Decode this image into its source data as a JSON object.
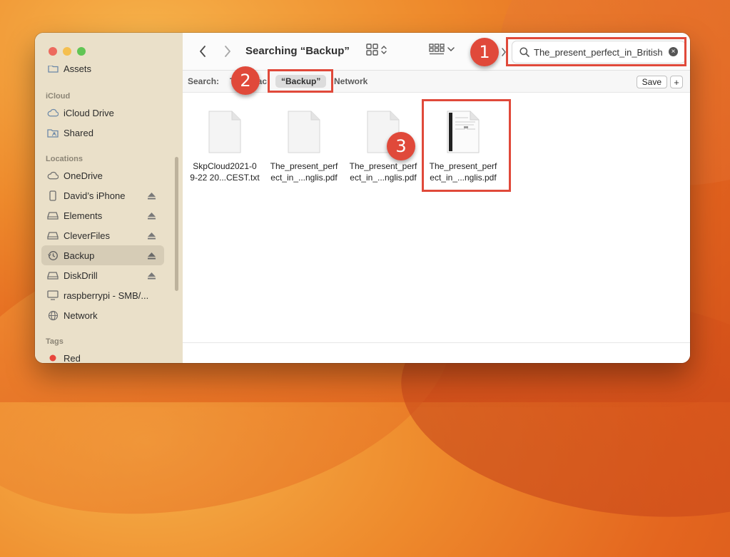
{
  "sidebar": {
    "items_top": [
      {
        "label": "Assets",
        "icon": "folder-icon"
      }
    ],
    "sections": [
      {
        "title": "iCloud",
        "items": [
          {
            "label": "iCloud Drive",
            "icon": "cloud-icon"
          },
          {
            "label": "Shared",
            "icon": "shared-folder-icon"
          }
        ]
      },
      {
        "title": "Locations",
        "items": [
          {
            "label": "OneDrive",
            "icon": "cloud-icon"
          },
          {
            "label": "David’s iPhone",
            "icon": "iphone-icon",
            "eject": true
          },
          {
            "label": "Elements",
            "icon": "drive-icon",
            "eject": true
          },
          {
            "label": "CleverFiles",
            "icon": "drive-icon",
            "eject": true
          },
          {
            "label": "Backup",
            "icon": "time-machine-icon",
            "eject": true,
            "selected": true
          },
          {
            "label": "DiskDrill",
            "icon": "drive-icon",
            "eject": true
          },
          {
            "label": "raspberrypi - SMB/...",
            "icon": "display-icon"
          },
          {
            "label": "Network",
            "icon": "globe-icon"
          }
        ]
      },
      {
        "title": "Tags",
        "items": [
          {
            "label": "Red",
            "icon": "red-tag-icon",
            "color": "#e8453c"
          }
        ]
      }
    ]
  },
  "toolbar": {
    "title": "Searching “Backup”",
    "search_value": "The_present_perfect_in_British"
  },
  "scope": {
    "label": "Search:",
    "partial_mac": "Th",
    "partial_mac_tail": "ac",
    "backup": "“Backup”",
    "network": "Network",
    "save": "Save",
    "plus": "+"
  },
  "files": [
    {
      "name": "SkpCloud2021-0\n9-22 20...CEST.txt",
      "thumb": "blank"
    },
    {
      "name": "The_present_perf\nect_in_...nglis.pdf",
      "thumb": "blank"
    },
    {
      "name": "The_present_perf\nect_in_...nglis.pdf",
      "thumb": "blank"
    },
    {
      "name": "The_present_perf\nect_in_...nglis.pdf",
      "thumb": "document"
    }
  ],
  "annotations": {
    "badge1": "1",
    "badge2": "2",
    "badge3": "3",
    "color": "#e0493a"
  }
}
